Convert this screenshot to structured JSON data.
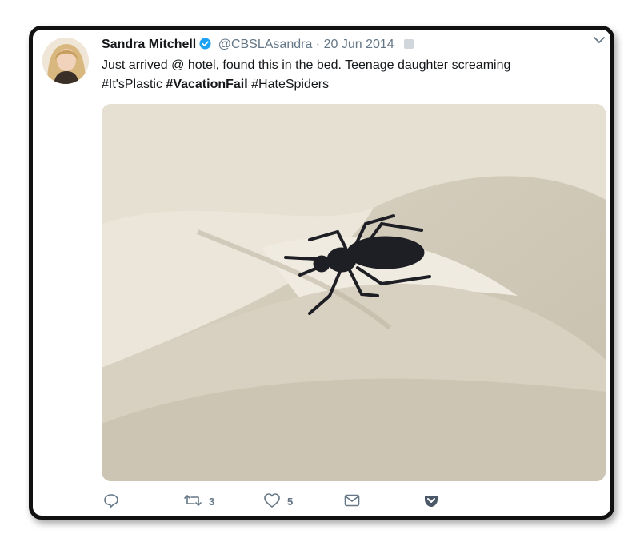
{
  "tweet": {
    "author_name": "Sandra Mitchell",
    "handle": "@CBSLAsandra",
    "separator": "·",
    "date": "20 Jun 2014",
    "text_line1": "Just arrived @ hotel, found this in the bed.   Teenage daughter screaming",
    "hashtag1": "#It'sPlastic",
    "hashtag2": "#VacationFail",
    "hashtag3": "#HateSpiders"
  },
  "actions": {
    "retweets": "3",
    "likes": "5"
  },
  "colors": {
    "verified": "#1da1f2",
    "muted": "#657786",
    "text": "#14171a"
  },
  "icons": [
    "verified-badge-icon",
    "chevron-down-icon",
    "reply-icon",
    "retweet-icon",
    "like-icon",
    "message-icon",
    "pocket-icon"
  ]
}
